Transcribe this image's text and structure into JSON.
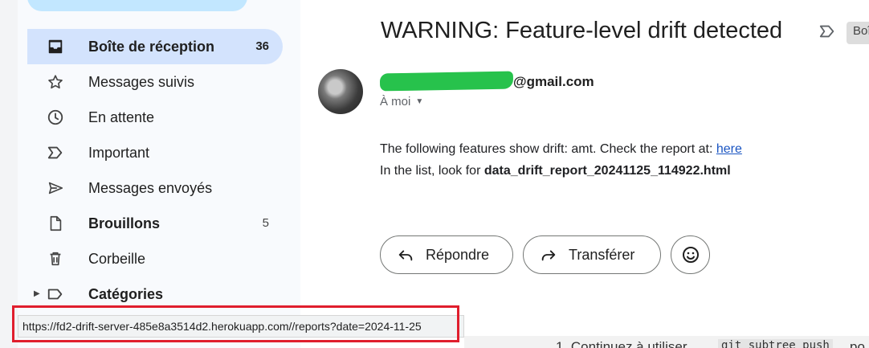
{
  "sidebar": {
    "items": [
      {
        "label": "Boîte de réception",
        "count": "36",
        "icon": "inbox-icon"
      },
      {
        "label": "Messages suivis",
        "count": "",
        "icon": "star-icon"
      },
      {
        "label": "En attente",
        "count": "",
        "icon": "clock-icon"
      },
      {
        "label": "Important",
        "count": "",
        "icon": "important-icon"
      },
      {
        "label": "Messages envoyés",
        "count": "",
        "icon": "send-icon"
      },
      {
        "label": "Brouillons",
        "count": "5",
        "icon": "draft-icon"
      },
      {
        "label": "Corbeille",
        "count": "",
        "icon": "trash-icon"
      },
      {
        "label": "Catégories",
        "count": "",
        "icon": "label-icon"
      }
    ]
  },
  "email": {
    "subject": "WARNING: Feature-level drift detected",
    "label_chip": "Boî",
    "sender_suffix": "@gmail.com",
    "to": "À moi",
    "body_line1": "The following features show drift: amt. Check the report at: ",
    "link_text": "here",
    "body_line2_prefix": "In the list, look for ",
    "body_line2_bold": "data_drift_report_20241125_114922.html",
    "reply_label": "Répondre",
    "forward_label": "Transférer"
  },
  "statusbar": {
    "url": "https://fd2-drift-server-485e8a3514d2.herokuapp.com//reports?date=2024-11-25"
  },
  "behind": {
    "text_prefix": "1. Continuez à utiliser",
    "code": "git subtree push",
    "text_suffix": "po"
  },
  "colors": {
    "active_nav": "#d3e3fd",
    "link": "#1a55c2",
    "highlight_box": "#e01e2d",
    "redaction": "#27c24c"
  }
}
